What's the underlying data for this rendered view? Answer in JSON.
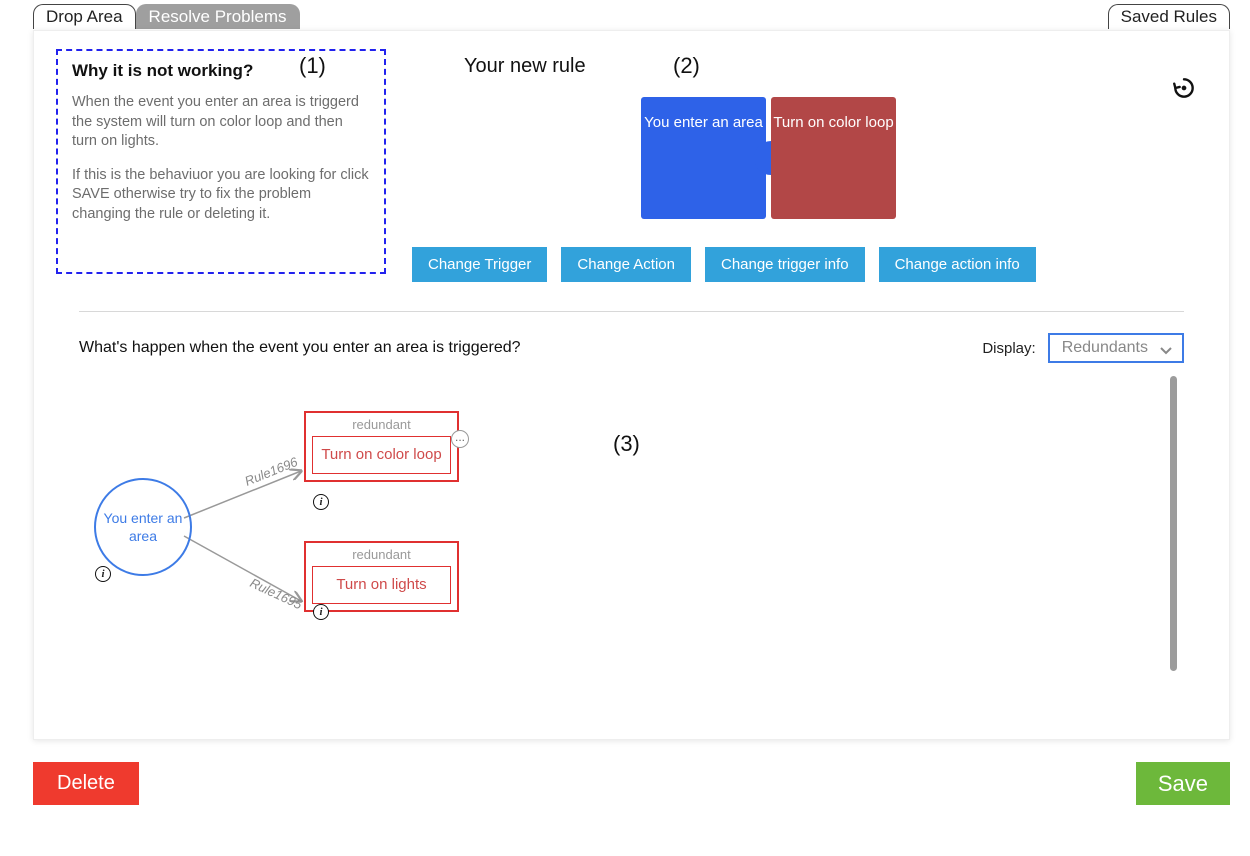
{
  "tabs": {
    "drop_area": "Drop Area",
    "resolve_problems": "Resolve Problems",
    "saved_rules": "Saved Rules"
  },
  "explain": {
    "title": "Why it is not working?",
    "p1": "When the event you enter an area is triggerd the system will turn on color loop and then turn on lights.",
    "p2": "If this is the behaviuor you are looking for click SAVE otherwise try to fix the problem changing the rule or deleting it."
  },
  "annotations": {
    "n1": "(1)",
    "n2": "(2)",
    "n3": "(3)"
  },
  "rule": {
    "title": "Your new rule",
    "trigger_text": "You enter an area",
    "action_text": "Turn on color loop"
  },
  "change_buttons": {
    "trigger": "Change Trigger",
    "action": "Change Action",
    "trigger_info": "Change trigger info",
    "action_info": "Change action info"
  },
  "section3": {
    "title": "What's happen when the event you enter an area is triggered?",
    "display_label": "Display:",
    "display_value": "Redundants"
  },
  "graph": {
    "event_label": "You enter an area",
    "edge_top": "Rule1696",
    "edge_bottom": "Rule1695",
    "box_top_tag": "redundant",
    "box_top_text": "Turn on color loop",
    "box_bottom_tag": "redundant",
    "box_bottom_text": "Turn on lights"
  },
  "footer": {
    "delete": "Delete",
    "save": "Save"
  },
  "icons": {
    "info": "i",
    "more": "..."
  }
}
